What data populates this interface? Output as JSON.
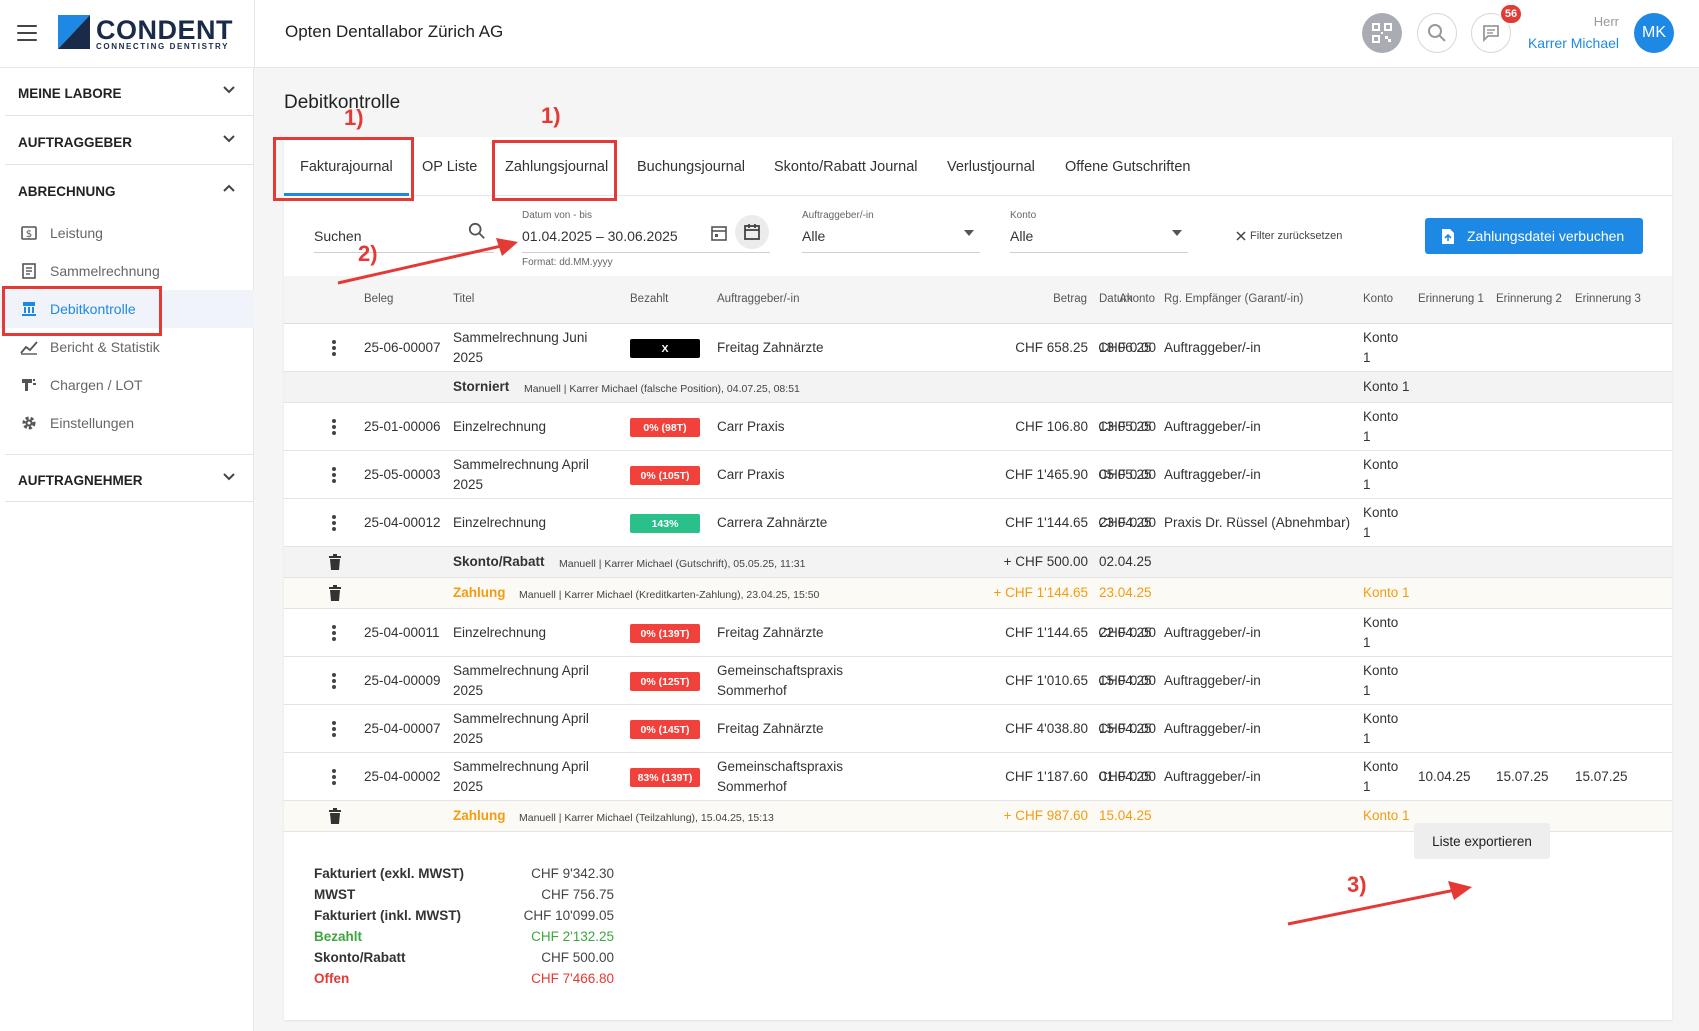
{
  "header": {
    "brand_name": "CONDENT",
    "brand_tagline": "CONNECTING DENTISTRY",
    "lab_name": "Opten Dentallabor Zürich AG",
    "notification_count": "56",
    "user_salutation": "Herr",
    "user_name": "Karrer Michael",
    "user_initials": "MK"
  },
  "sidebar": {
    "sections": {
      "meine_labore": "MEINE LABORE",
      "auftraggeber": "AUFTRAGGEBER",
      "abrechnung": "ABRECHNUNG",
      "auftragnehmer": "AUFTRAGNEHMER"
    },
    "items": [
      {
        "label": "Leistung",
        "icon": "dollar-document-icon"
      },
      {
        "label": "Sammelrechnung",
        "icon": "invoice-icon"
      },
      {
        "label": "Debitkontrolle",
        "icon": "bank-icon",
        "active": true
      },
      {
        "label": "Bericht & Statistik",
        "icon": "chart-icon"
      },
      {
        "label": "Chargen / LOT",
        "icon": "barcode-icon"
      },
      {
        "label": "Einstellungen",
        "icon": "gear-icon"
      }
    ]
  },
  "page": {
    "title": "Debitkontrolle",
    "tabs": [
      "Fakturajournal",
      "OP Liste",
      "Zahlungsjournal",
      "Buchungsjournal",
      "Skonto/Rabatt Journal",
      "Verlustjournal",
      "Offene Gutschriften"
    ],
    "active_tab": "Fakturajournal"
  },
  "filters": {
    "search_label": "Suchen",
    "date_label": "Datum von - bis",
    "date_value": "01.04.2025 – 30.06.2025",
    "date_format": "Format: dd.MM.yyyy",
    "client_label": "Auftraggeber/-in",
    "client_value": "Alle",
    "account_label": "Konto",
    "account_value": "Alle",
    "reset_label": "Filter zurücksetzen",
    "upload_button": "Zahlungsdatei verbuchen"
  },
  "table": {
    "columns": [
      "Beleg",
      "Titel",
      "Bezahlt",
      "Auftraggeber/-in",
      "Betrag",
      "Akonto",
      "Datum",
      "Rg. Empfänger (Garant/-in)",
      "Konto",
      "Erinnerung 1",
      "Erinnerung 2",
      "Erinnerung 3"
    ],
    "rows": [
      {
        "beleg": "25-06-00007",
        "titel": [
          "Sammelrechnung Juni",
          "2025"
        ],
        "bezahlt": "X",
        "color": "black",
        "client": [
          "Freitag Zahnärzte"
        ],
        "betrag": "CHF 658.25",
        "akonto": "CHF 0.00",
        "datum": "18.06.25",
        "empf": "Auftraggeber/-in",
        "konto": [
          "Konto",
          "1"
        ]
      },
      {
        "beleg": "25-01-00006",
        "titel": [
          "Einzelrechnung"
        ],
        "bezahlt": "0% (98T)",
        "color": "red",
        "client": [
          "Carr Praxis"
        ],
        "betrag": "CHF 106.80",
        "akonto": "CHF 0.00",
        "datum": "13.05.25",
        "empf": "Auftraggeber/-in",
        "konto": [
          "Konto",
          "1"
        ]
      },
      {
        "beleg": "25-05-00003",
        "titel": [
          "Sammelrechnung April",
          "2025"
        ],
        "bezahlt": "0% (105T)",
        "color": "red",
        "client": [
          "Carr Praxis"
        ],
        "betrag": "CHF 1'465.90",
        "akonto": "CHF 0.00",
        "datum": "05.05.25",
        "empf": "Auftraggeber/-in",
        "konto": [
          "Konto",
          "1"
        ]
      },
      {
        "beleg": "25-04-00012",
        "titel": [
          "Einzelrechnung"
        ],
        "bezahlt": "143%",
        "color": "green",
        "client": [
          "Carrera Zahnärzte"
        ],
        "betrag": "CHF 1'144.65",
        "akonto": "CHF 0.00",
        "datum": "23.04.25",
        "empf": "Praxis Dr. Rüssel (Abnehmbar)",
        "konto": [
          "Konto",
          "1"
        ]
      },
      {
        "beleg": "25-04-00011",
        "titel": [
          "Einzelrechnung"
        ],
        "bezahlt": "0% (139T)",
        "color": "red",
        "client": [
          "Freitag Zahnärzte"
        ],
        "betrag": "CHF 1'144.65",
        "akonto": "CHF 0.00",
        "datum": "22.04.25",
        "empf": "Auftraggeber/-in",
        "konto": [
          "Konto",
          "1"
        ]
      },
      {
        "beleg": "25-04-00009",
        "titel": [
          "Sammelrechnung April",
          "2025"
        ],
        "bezahlt": "0% (125T)",
        "color": "red",
        "client": [
          "Gemeinschaftspraxis",
          "Sommerhof"
        ],
        "betrag": "CHF 1'010.65",
        "akonto": "CHF 0.00",
        "datum": "15.04.25",
        "empf": "Auftraggeber/-in",
        "konto": [
          "Konto",
          "1"
        ]
      },
      {
        "beleg": "25-04-00007",
        "titel": [
          "Sammelrechnung April",
          "2025"
        ],
        "bezahlt": "0% (145T)",
        "color": "red",
        "client": [
          "Freitag Zahnärzte"
        ],
        "betrag": "CHF 4'038.80",
        "akonto": "CHF 0.00",
        "datum": "15.04.25",
        "empf": "Auftraggeber/-in",
        "konto": [
          "Konto",
          "1"
        ]
      },
      {
        "beleg": "25-04-00002",
        "titel": [
          "Sammelrechnung April",
          "2025"
        ],
        "bezahlt": "83% (139T)",
        "color": "red",
        "client": [
          "Gemeinschaftspraxis",
          "Sommerhof"
        ],
        "betrag": "CHF 1'187.60",
        "akonto": "CHF 0.00",
        "datum": "01.04.25",
        "empf": "Auftraggeber/-in",
        "konto": [
          "Konto",
          "1"
        ],
        "erinnerung": [
          "10.04.25",
          "15.07.25",
          "15.07.25"
        ]
      }
    ],
    "subrows": {
      "storniert": {
        "label": "Storniert",
        "info": "Manuell | Karrer Michael (falsche Position), 04.07.25, 08:51",
        "konto": "Konto 1"
      },
      "skonto": {
        "label": "Skonto/Rabatt",
        "info": "Manuell | Karrer Michael (Gutschrift), 05.05.25, 11:31",
        "betrag": "+ CHF 500.00",
        "datum": "02.04.25"
      },
      "zahlung1": {
        "label": "Zahlung",
        "info": "Manuell | Karrer Michael (Kreditkarten-Zahlung), 23.04.25, 15:50",
        "betrag": "+ CHF 1'144.65",
        "datum": "23.04.25",
        "konto": "Konto 1"
      },
      "zahlung2": {
        "label": "Zahlung",
        "info": "Manuell | Karrer Michael (Teilzahlung), 15.04.25, 15:13",
        "betrag": "+ CHF 987.60",
        "datum": "15.04.25",
        "konto": "Konto 1"
      }
    }
  },
  "summary": {
    "fakturiert_exkl_label": "Fakturiert (exkl. MWST)",
    "fakturiert_exkl": "CHF 9'342.30",
    "mwst_label": "MWST",
    "mwst": "CHF 756.75",
    "fakturiert_inkl_label": "Fakturiert (inkl. MWST)",
    "fakturiert_inkl": "CHF 10'099.05",
    "bezahlt_label": "Bezahlt",
    "bezahlt": "CHF 2'132.25",
    "skonto_label": "Skonto/Rabatt",
    "skonto": "CHF 500.00",
    "offen_label": "Offen",
    "offen": "CHF 7'466.80"
  },
  "export_button": "Liste exportieren",
  "annotations": {
    "a1": "1)",
    "a2": "2)",
    "a3": "3)"
  },
  "colors": {
    "accent": "#1e88e5",
    "danger": "#f2403b",
    "success": "#2ac08a",
    "warning": "#f39c12",
    "highlight": "#e53935"
  }
}
